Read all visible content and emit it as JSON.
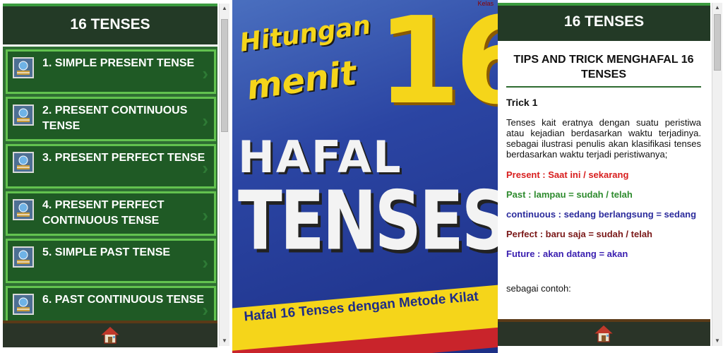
{
  "left_screen": {
    "header_title": "16 TENSES",
    "items": [
      {
        "label": "1. SIMPLE PRESENT TENSE"
      },
      {
        "label": "2. PRESENT CONTINUOUS TENSE"
      },
      {
        "label": "3. PRESENT PERFECT TENSE"
      },
      {
        "label": "4. PRESENT PERFECT CONTINUOUS TENSE"
      },
      {
        "label": "5. SIMPLE PAST TENSE"
      },
      {
        "label": "6. PAST CONTINUOUS TENSE"
      }
    ],
    "item_icon": "book-globe-icon",
    "footer_icon": "home-icon"
  },
  "cover": {
    "badge": "Kelas",
    "line1": "Hitungan",
    "line2": "menit",
    "number": "16",
    "line3": "HAFAL",
    "line4": "TENSES",
    "subtitle": "Hafal 16 Tenses dengan Metode Kilat"
  },
  "right_screen": {
    "header_title": "16 TENSES",
    "article_title": "TIPS AND TRICK MENGHAFAL 16 TENSES",
    "trick_heading": "Trick 1",
    "intro": "Tenses kait eratnya dengan suatu peristiwa atau kejadian berdasarkan waktu terjadinya. sebagai ilustrasi penulis akan klasifikasi tenses berdasarkan waktu terjadi peristiwanya;",
    "lines": [
      {
        "text": "Present : Saat ini / sekarang",
        "color": "#d81e1e"
      },
      {
        "text": "Past : lampau = sudah / telah",
        "color": "#2e8b2e"
      },
      {
        "text": "continuous : sedang berlangsung = sedang",
        "color": "#2b2b9c"
      },
      {
        "text": "Perfect : baru saja = sudah / telah",
        "color": "#7a1818"
      },
      {
        "text": "Future : akan datang = akan",
        "color": "#3a1fb0"
      }
    ],
    "outro": "sebagai contoh:",
    "footer_icon": "home-icon"
  },
  "colors": {
    "header_bg": "#233a26",
    "accent_green": "#3b9b3f",
    "item_bg": "#1f5a25",
    "item_border": "#62c24f",
    "cover_yellow": "#f5d51a",
    "cover_blue": "#2b45a3"
  }
}
